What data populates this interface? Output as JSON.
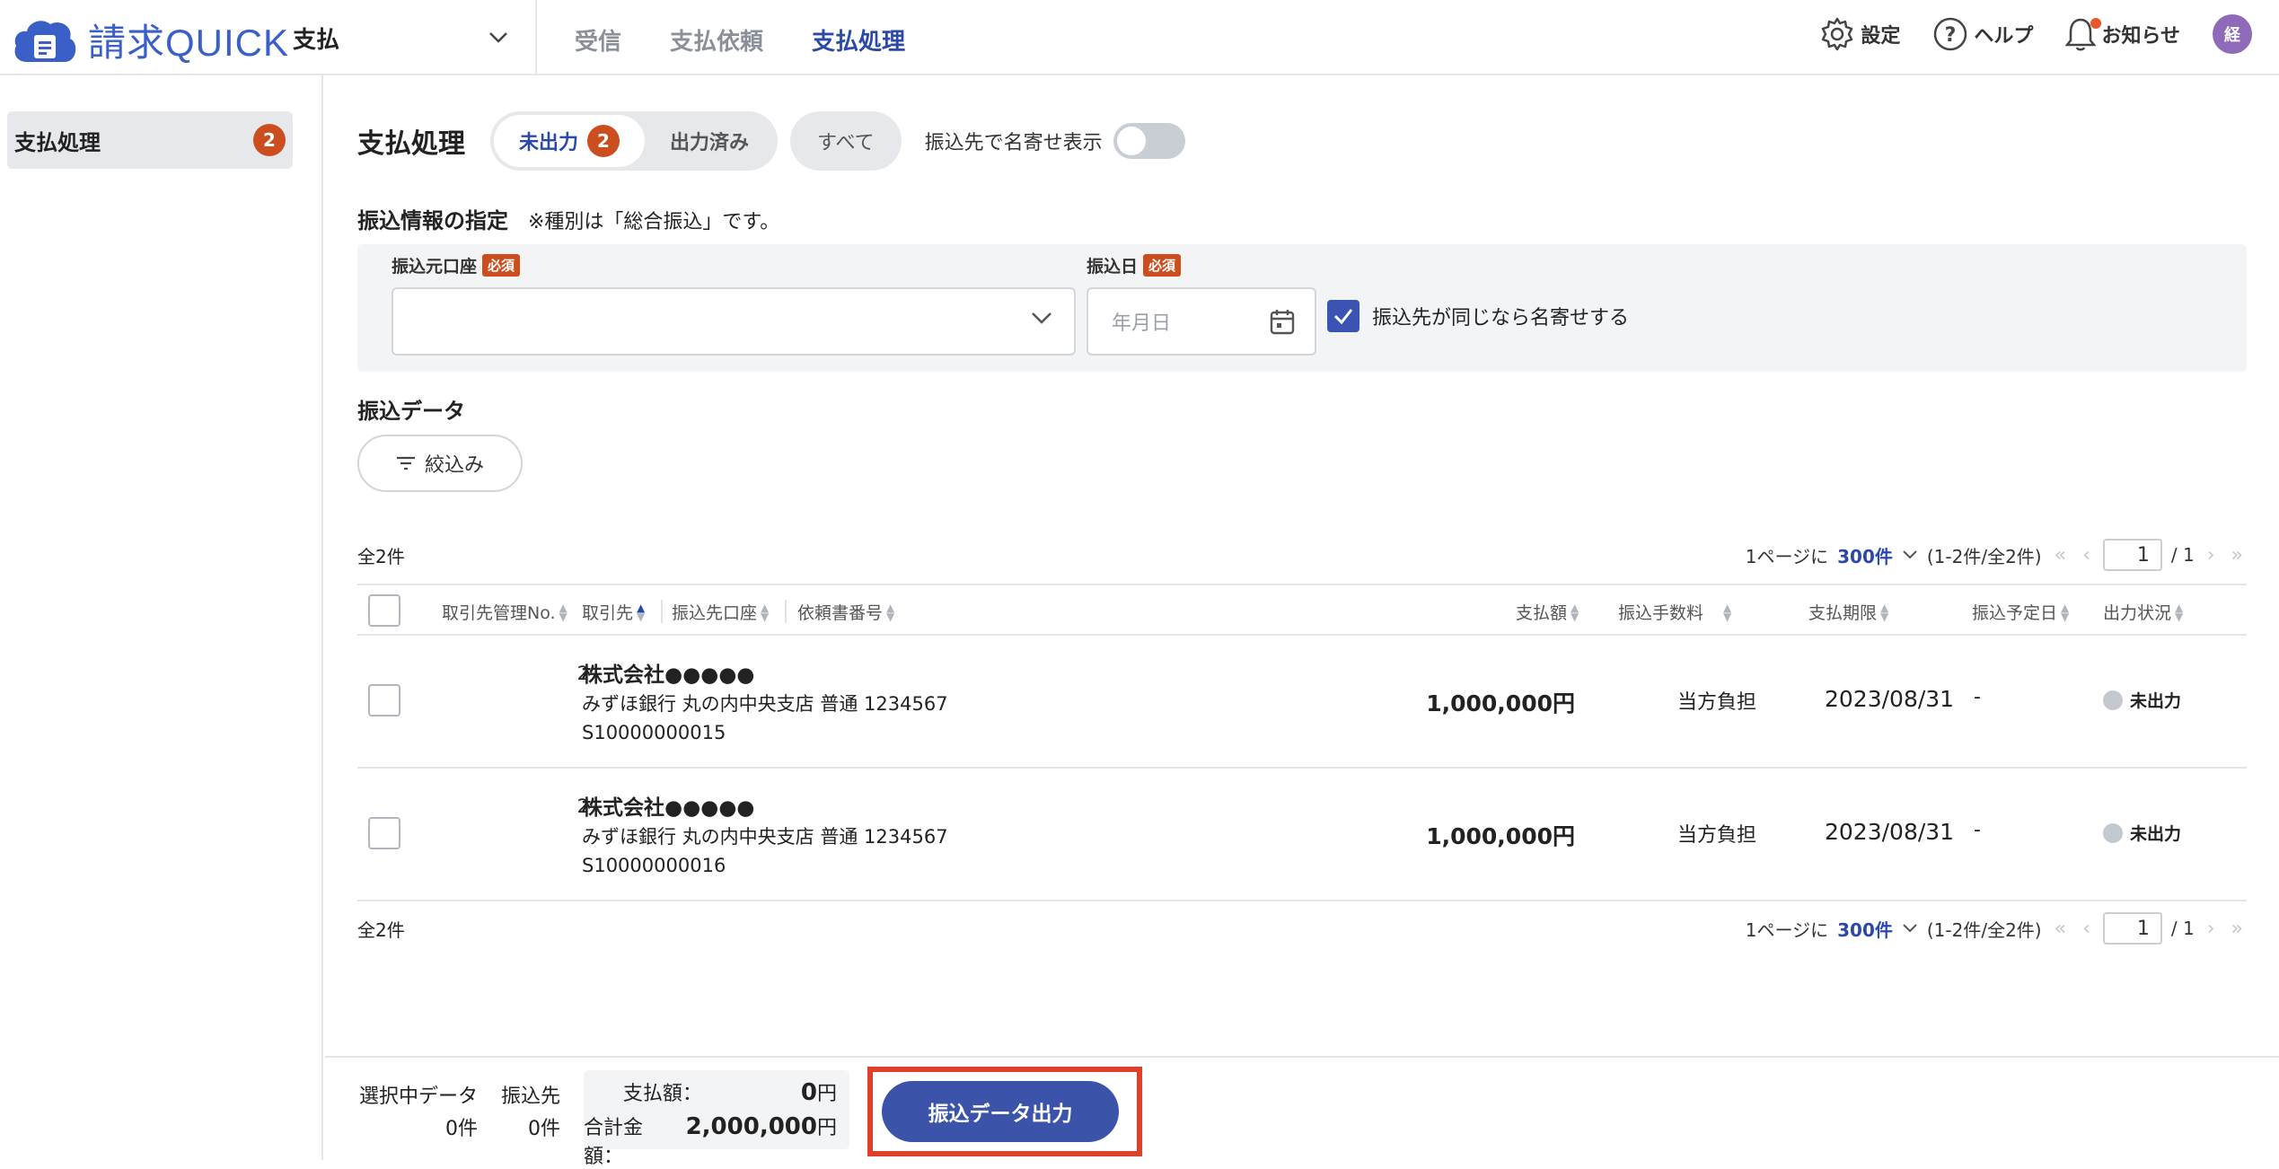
{
  "app": {
    "logo_text": "請求QUICK",
    "module": "支払"
  },
  "top_nav": [
    {
      "label": "受信"
    },
    {
      "label": "支払依頼"
    },
    {
      "label": "支払処理"
    }
  ],
  "header_right": {
    "settings": "設定",
    "help": "ヘルプ",
    "notices": "お知らせ",
    "avatar": "経"
  },
  "sidebar": {
    "items": [
      {
        "label": "支払処理",
        "count": "2"
      }
    ]
  },
  "page": {
    "title": "支払処理",
    "tabs": [
      {
        "label": "未出力",
        "count": "2"
      },
      {
        "label": "出力済み"
      }
    ],
    "all_tab": "すべて",
    "group_toggle_label": "振込先で名寄せ表示"
  },
  "transfer_info": {
    "title": "振込情報の指定",
    "note": "※種別は「総合振込」です。",
    "source_account_label": "振込元口座",
    "required": "必須",
    "source_account_value": "",
    "date_label": "振込日",
    "date_placeholder": "年月日",
    "merge_checkbox_label": "振込先が同じなら名寄せする"
  },
  "transfer_data": {
    "title": "振込データ",
    "filter_label": "絞込み",
    "total_count": "全2件",
    "per_page_prefix": "1ページに",
    "per_page_value": "300件",
    "range": "(1-2件/全2件)",
    "page": "1",
    "page_total": "/ 1",
    "columns": {
      "client_no": "取引先管理No.",
      "client": "取引先",
      "account": "振込先口座",
      "request_no": "依頼書番号",
      "amount": "支払額",
      "fee": "振込手数料",
      "due": "支払期限",
      "scheduled": "振込予定日",
      "status": "出力状況"
    },
    "rows": [
      {
        "no": "2",
        "name": "株式会社●●●●●",
        "account": "みずほ銀行 丸の内中央支店 普通 1234567",
        "request_no": "S10000000015",
        "amount": "1,000,000円",
        "fee": "当方負担",
        "due": "2023/08/31",
        "scheduled": "-",
        "status": "未出力"
      },
      {
        "no": "2",
        "name": "株式会社●●●●●",
        "account": "みずほ銀行 丸の内中央支店 普通 1234567",
        "request_no": "S10000000016",
        "amount": "1,000,000円",
        "fee": "当方負担",
        "due": "2023/08/31",
        "scheduled": "-",
        "status": "未出力"
      }
    ]
  },
  "footer": {
    "selected_label": "選択中データ",
    "selected_value": "0件",
    "payee_label": "振込先",
    "payee_value": "0件",
    "pay_amount_label": "支払額：",
    "pay_amount_value": "0",
    "total_label": "合計金額：",
    "total_value": "2,000,000",
    "yen": "円",
    "export_button": "振込データ出力"
  },
  "colors": {
    "accent": "#2b4aa8",
    "badge": "#cc4e1f",
    "button": "#3b53a8",
    "highlight": "#e0402a"
  }
}
